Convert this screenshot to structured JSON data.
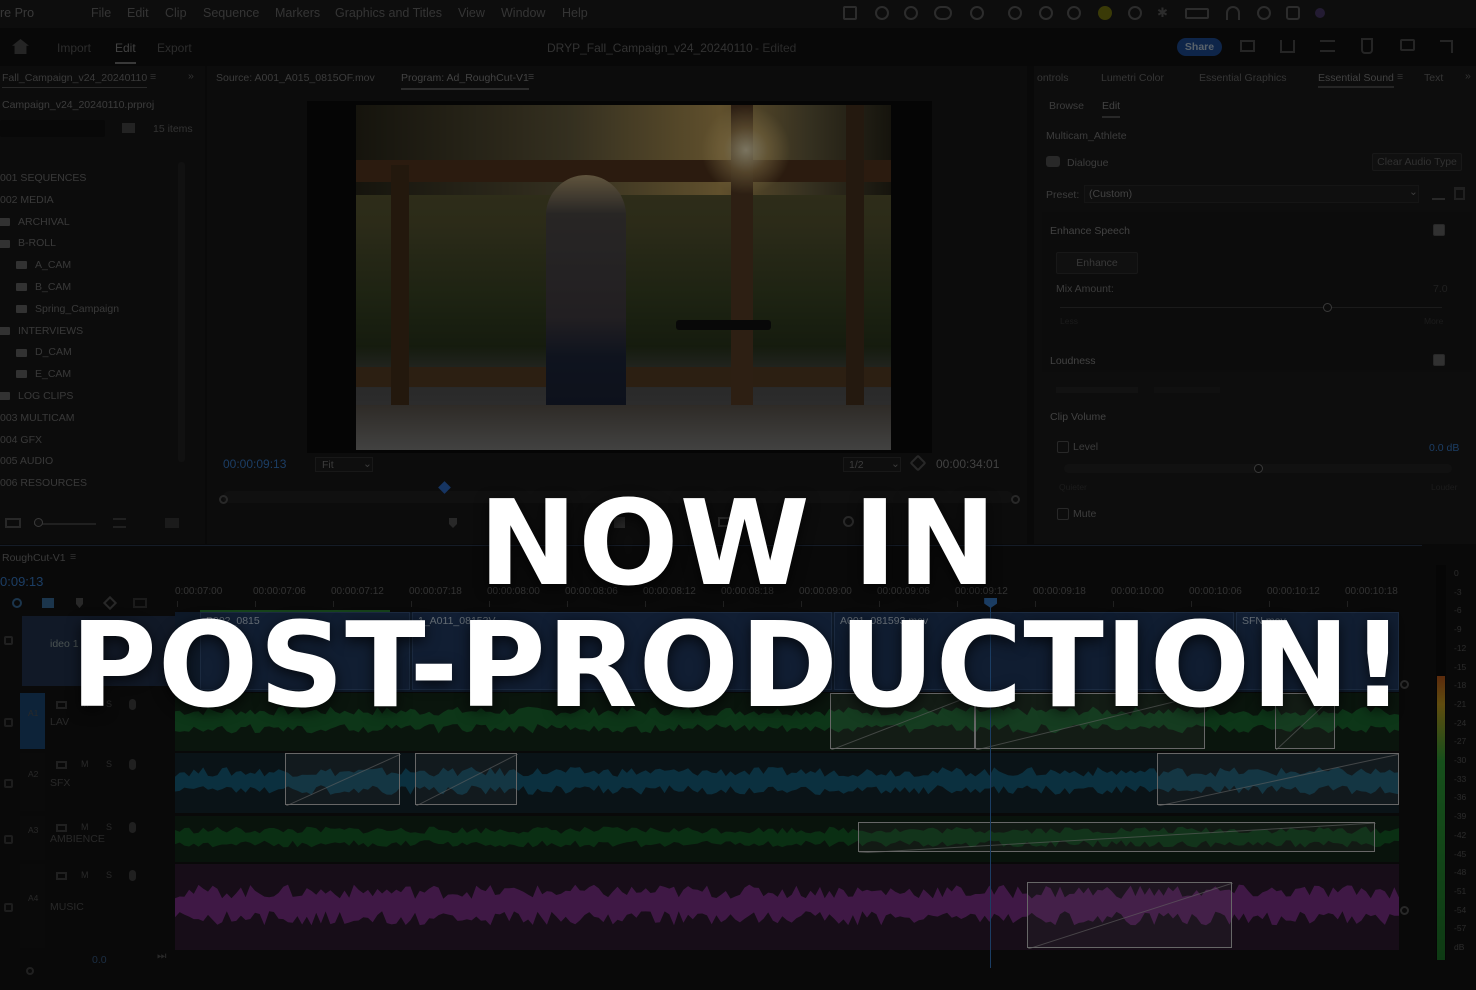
{
  "menubar": {
    "app_name": "re Pro",
    "items": [
      "File",
      "Edit",
      "Clip",
      "Sequence",
      "Markers",
      "Graphics and Titles",
      "View",
      "Window",
      "Help"
    ]
  },
  "header": {
    "tabs": [
      "Import",
      "Edit",
      "Export"
    ],
    "active_tab": "Edit",
    "title": "DRYP_Fall_Campaign_v24_20240110",
    "status": "- Edited",
    "share_label": "Share"
  },
  "project": {
    "tab_label": "Fall_Campaign_v24_20240110",
    "file_name": "Campaign_v24_20240110.prproj",
    "item_count": "15 items",
    "items": [
      {
        "label": "001 SEQUENCES",
        "indent": 0,
        "folder": false
      },
      {
        "label": "002 MEDIA",
        "indent": 0,
        "folder": false
      },
      {
        "label": "ARCHIVAL",
        "indent": 1,
        "folder": true
      },
      {
        "label": "B-ROLL",
        "indent": 1,
        "folder": true
      },
      {
        "label": "A_CAM",
        "indent": 2,
        "folder": true
      },
      {
        "label": "B_CAM",
        "indent": 2,
        "folder": true
      },
      {
        "label": "Spring_Campaign",
        "indent": 2,
        "folder": true
      },
      {
        "label": "INTERVIEWS",
        "indent": 1,
        "folder": true
      },
      {
        "label": "D_CAM",
        "indent": 2,
        "folder": true
      },
      {
        "label": "E_CAM",
        "indent": 2,
        "folder": true
      },
      {
        "label": "LOG CLIPS",
        "indent": 1,
        "folder": true
      },
      {
        "label": "003 MULTICAM",
        "indent": 0,
        "folder": false
      },
      {
        "label": "004 GFX",
        "indent": 0,
        "folder": false
      },
      {
        "label": "005 AUDIO",
        "indent": 0,
        "folder": false
      },
      {
        "label": "006 RESOURCES",
        "indent": 0,
        "folder": false
      }
    ]
  },
  "monitor": {
    "source_tab": "Source: A001_A015_0815OF.mov",
    "program_tab": "Program: Ad_RoughCut-V1",
    "timecode_current": "00:00:09:13",
    "fit_label": "Fit",
    "resolution": "1/2",
    "timecode_duration": "00:00:34:01",
    "playhead_fraction": 0.28
  },
  "essential_sound": {
    "tabs": [
      "ontrols",
      "Lumetri Color",
      "Essential Graphics",
      "Essential Sound",
      "Text"
    ],
    "active_tab": "Essential Sound",
    "subtabs": [
      "Browse",
      "Edit"
    ],
    "active_subtab": "Edit",
    "clip_name": "Multicam_Athlete",
    "type_label": "Dialogue",
    "clear_label": "Clear Audio Type",
    "preset_label": "Preset:",
    "preset_value": "(Custom)",
    "enhance_speech_label": "Enhance Speech",
    "enhance_button": "Enhance",
    "mix_amount_label": "Mix Amount:",
    "mix_value": "7.0",
    "mix_less": "Less",
    "mix_more": "More",
    "mix_fraction": 0.7,
    "loudness_label": "Loudness",
    "clip_volume_label": "Clip Volume",
    "level_label": "Level",
    "level_value": "0.0 dB",
    "level_fraction": 0.5,
    "quieter": "Quieter",
    "louder": "Louder",
    "mute_label": "Mute"
  },
  "timeline": {
    "sequence_name": "RoughCut-V1",
    "timecode": "0:09:13",
    "ruler": [
      "0:00:07:00",
      "00:00:07:06",
      "00:00:07:12",
      "00:00:07:18",
      "00:00:08:00",
      "00:00:08:06",
      "00:00:08:12",
      "00:00:08:18",
      "00:00:09:00",
      "00:00:09:06",
      "00:00:09:12",
      "00:00:09:18",
      "00:00:10:00",
      "00:00:10:06",
      "00:00:10:12",
      "00:00:10:18"
    ],
    "playhead_fraction": 0.666,
    "video_track_label": "ideo 1",
    "video_clips": [
      "B002_0815",
      "1_A011_08153V",
      "A001_081593.mov",
      "SFN.mov"
    ],
    "tracks": [
      {
        "id": "A1",
        "name": "LAV",
        "color": "#1f8a3c"
      },
      {
        "id": "A2",
        "name": "SFX",
        "color": "#1a7aa0"
      },
      {
        "id": "A3",
        "name": "AMBIENCE",
        "color": "#16762f"
      },
      {
        "id": "A4",
        "name": "MUSIC",
        "color": "#a23cb0"
      }
    ],
    "track_controls": [
      "M",
      "S"
    ],
    "master_value": "0.0"
  },
  "meter": {
    "scale": [
      "0",
      "-3",
      "-6",
      "-9",
      "-12",
      "-15",
      "-18",
      "-21",
      "-24",
      "-27",
      "-30",
      "-33",
      "-36",
      "-39",
      "-42",
      "-45",
      "-48",
      "-51",
      "-54",
      "-57",
      "dB"
    ],
    "level_fraction": 0.72
  },
  "overlay": {
    "line1": "NOW IN",
    "line2": "POST-PRODUCTION!"
  }
}
